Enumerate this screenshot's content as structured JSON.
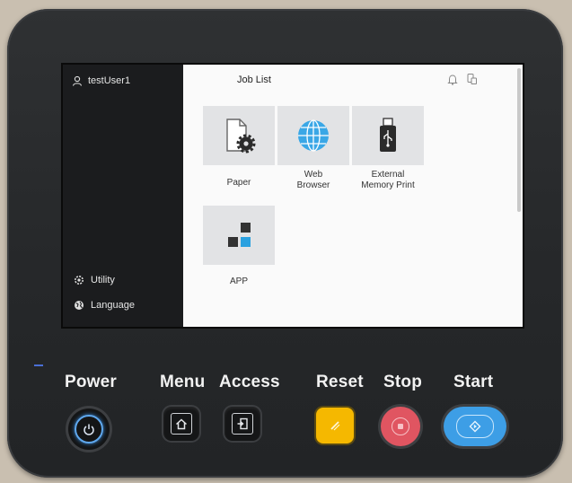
{
  "screen": {
    "user": "testUser1",
    "job_list": "Job List",
    "sidebar_bottom": [
      {
        "label": "Utility",
        "icon": "gear-icon"
      },
      {
        "label": "Language",
        "icon": "globe-icon"
      }
    ],
    "apps": [
      {
        "label": "Paper",
        "icon": "paper-settings-icon"
      },
      {
        "label": "Web Browser",
        "label_lines": [
          "Web",
          "Browser"
        ],
        "icon": "globe-icon"
      },
      {
        "label": "External Memory Print",
        "label_lines": [
          "External",
          "Memory Print"
        ],
        "icon": "usb-drive-icon"
      },
      {
        "label": "APP",
        "icon": "app-grid-icon"
      }
    ]
  },
  "panel": {
    "power": "Power",
    "menu": "Menu",
    "access": "Access",
    "reset": "Reset",
    "stop": "Stop",
    "start": "Start"
  },
  "colors": {
    "reset": "#f5b800",
    "stop": "#e05561",
    "start": "#3d9ee6",
    "accent_blue": "#2aa1e0",
    "tile_bg": "#e2e3e5",
    "sidebar_bg": "#1b1c1e"
  }
}
